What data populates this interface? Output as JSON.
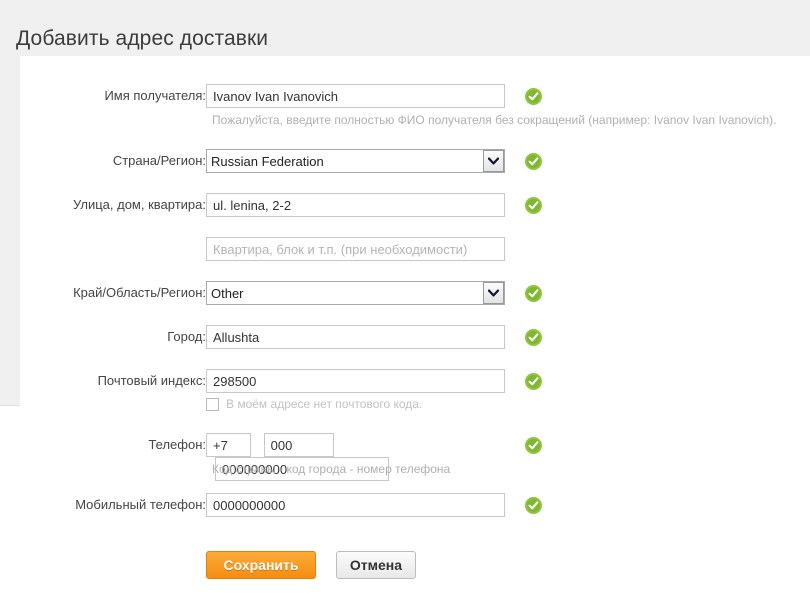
{
  "header": {
    "title": "Добавить адрес доставки"
  },
  "colors": {
    "accent_orange": "#f68d11",
    "valid_green": "#8cc63e",
    "header_bg": "#f0f0f0",
    "text": "#444444",
    "hint_text": "#b0b0b0"
  },
  "form": {
    "recipient_name": {
      "label": "Имя получателя:",
      "value": "Ivanov Ivan Ivanovich",
      "placeholder": "",
      "hint": "Пожалуйста, введите полностью ФИО получателя без сокращений (например: Ivanov Ivan Ivanovich).",
      "status": "valid"
    },
    "country": {
      "label": "Страна/Регион:",
      "value": "Russian Federation",
      "options": [
        "Russian Federation"
      ],
      "status": "valid"
    },
    "street": {
      "label": "Улица, дом, квартира:",
      "value": "ul. lenina, 2-2",
      "placeholder": "",
      "status": "valid"
    },
    "apartment": {
      "label": "",
      "value": "",
      "placeholder": "Квартира, блок и т.п. (при необходимости)",
      "status": "none"
    },
    "region": {
      "label": "Край/Область/Регион:",
      "value": "Other",
      "options": [
        "Other"
      ],
      "status": "valid"
    },
    "city": {
      "label": "Город:",
      "value": "Allushta",
      "placeholder": "",
      "status": "valid"
    },
    "postal_code": {
      "label": "Почтовый индекс:",
      "value": "298500",
      "placeholder": "",
      "status": "valid"
    },
    "no_postal_code": {
      "label": "В моём адресе нет почтового кода.",
      "checked": false
    },
    "phone": {
      "label": "Телефон:",
      "country_code": "+7",
      "area_code": "000",
      "number": "000000000",
      "hint": "Код страны - код города - номер телефона",
      "status": "valid"
    },
    "mobile_phone": {
      "label": "Мобильный телефон:",
      "value": "0000000000",
      "placeholder": "",
      "status": "valid"
    }
  },
  "actions": {
    "save": "Сохранить",
    "cancel": "Отмена"
  },
  "icons": {
    "valid": "check-circle-icon",
    "dropdown": "chevron-down-icon",
    "checkbox": "checkbox-unchecked-icon"
  }
}
